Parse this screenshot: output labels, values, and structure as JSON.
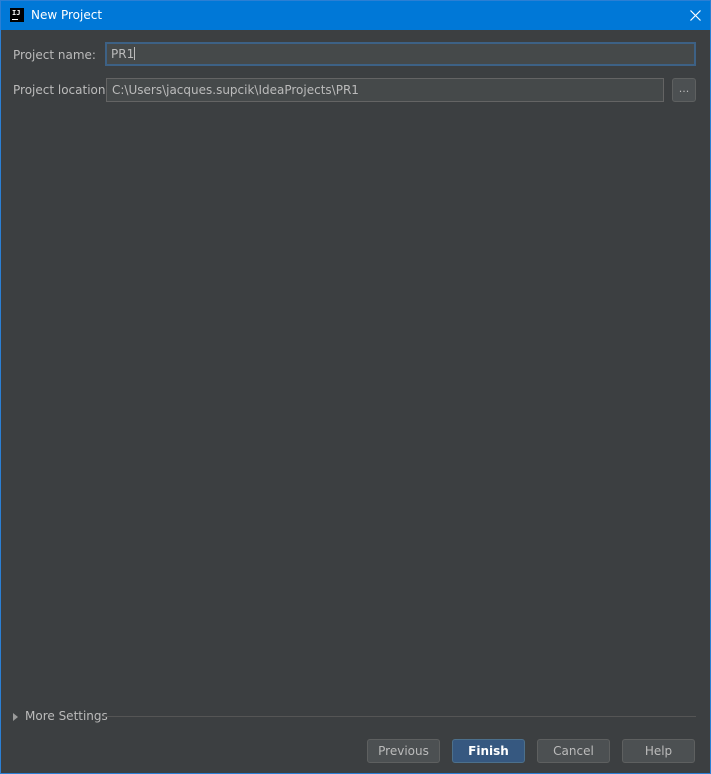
{
  "window": {
    "title": "New Project",
    "app_icon_text": "IJ"
  },
  "form": {
    "project_name_label": "Project name:",
    "project_name_value": "PR1",
    "project_location_label": "Project location:",
    "project_location_value": "C:\\Users\\jacques.supcik\\IdeaProjects\\PR1",
    "browse_label": "..."
  },
  "more_settings": {
    "label": "More Settings"
  },
  "buttons": {
    "previous": "Previous",
    "finish": "Finish",
    "cancel": "Cancel",
    "help": "Help"
  },
  "colors": {
    "titlebar": "#0078d7",
    "background": "#3c3f41",
    "primary_button": "#365880"
  },
  "icons": {
    "app": "intellij-idea-icon",
    "close": "close-icon",
    "expand": "triangle-right-icon"
  }
}
